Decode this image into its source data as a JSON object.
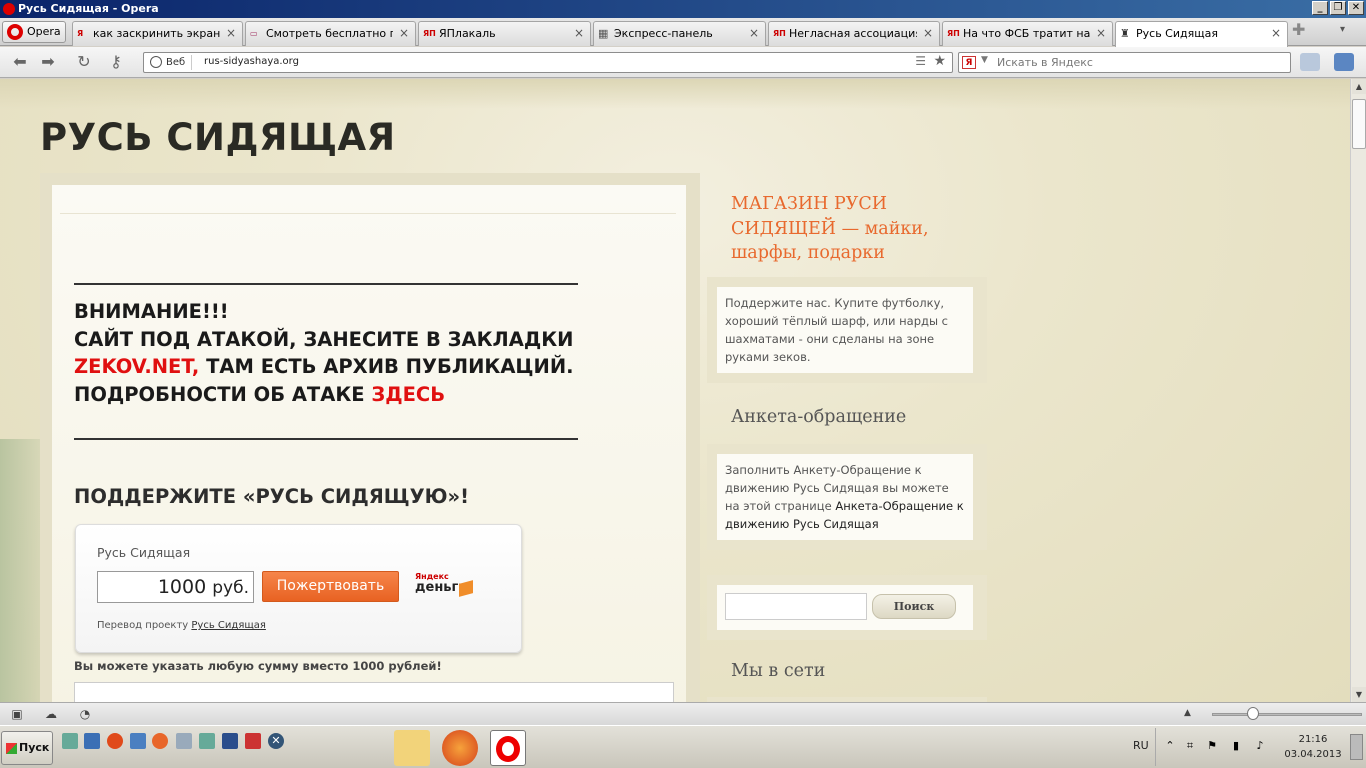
{
  "window": {
    "title": "Русь Сидящая - Opera",
    "buttons": [
      "_",
      "❐",
      "✕"
    ]
  },
  "tabs": [
    {
      "label": "как заскринить экран н...",
      "icon": "yandex-icon",
      "fav": "Я"
    },
    {
      "label": "Смотреть бесплатно по...",
      "icon": "tv-icon",
      "fav": "▭"
    },
    {
      "label": "ЯПлакаль",
      "icon": "yaplakal-icon",
      "fav": "ЯП"
    },
    {
      "label": "Экспресс-панель",
      "icon": "speed-dial-icon",
      "fav": "▦"
    },
    {
      "label": "Негласная ассоциация ...",
      "icon": "yaplakal-icon",
      "fav": "ЯП"
    },
    {
      "label": "На что ФСБ тратит наш...",
      "icon": "yaplakal-icon",
      "fav": "ЯП"
    },
    {
      "label": "Русь Сидящая",
      "icon": "site-icon",
      "fav": "♜",
      "active": true
    }
  ],
  "menu": {
    "label": "Opera"
  },
  "address": {
    "scope": "Веб",
    "url": "rus-sidyashaya.org"
  },
  "search": {
    "engine": "Я",
    "placeholder": "Искать в Яндекс"
  },
  "page": {
    "site_title": "РУСЬ СИДЯЩАЯ",
    "alert": {
      "line1": "ВНИМАНИЕ!!!",
      "line2": "САЙТ ПОД АТАКОЙ, ЗАНЕСИТЕ В ЗАКЛАДКИ",
      "link1": "ZEKOV.NET,",
      "line3_rest": " ТАМ ЕСТЬ АРХИВ ПУБЛИКАЦИЙ.",
      "line4": "ПОДРОБНОСТИ ОБ АТАКЕ ",
      "link2": "ЗДЕСЬ"
    },
    "support_title": "ПОДДЕРЖИТЕ «РУСЬ СИДЯЩУЮ»!",
    "donate": {
      "title": "Русь Сидящая",
      "amount": "1000",
      "currency": "руб.",
      "button": "Пожертвовать",
      "ym_small": "Яндекс",
      "ym_big": "деньги",
      "note_prefix": "Перевод проекту ",
      "note_link": "Русь Сидящая"
    },
    "any_sum": "Вы можете указать любую сумму вместо 1000 рублей!"
  },
  "sidebar": {
    "shop_link": "МАГАЗИН РУСИ СИДЯЩЕЙ — майки, шарфы, подарки",
    "shop_text": "Поддержите нас. Купите футболку, хороший тёплый шарф, или нарды с шахматами - они сделаны на зоне руками зеков.",
    "survey_heading": "Анкета-обращение",
    "survey_text": "Заполнить Анкету-Обращение к движению Русь Сидящая вы можете на этой странице ",
    "survey_link": "Анкета-Обращение к движению Русь Сидящая",
    "search_button": "Поиск",
    "social_heading": "Мы в сети"
  },
  "taskbar": {
    "start": "Пуск",
    "lang": "RU",
    "time": "21:16",
    "date": "03.04.2013"
  }
}
